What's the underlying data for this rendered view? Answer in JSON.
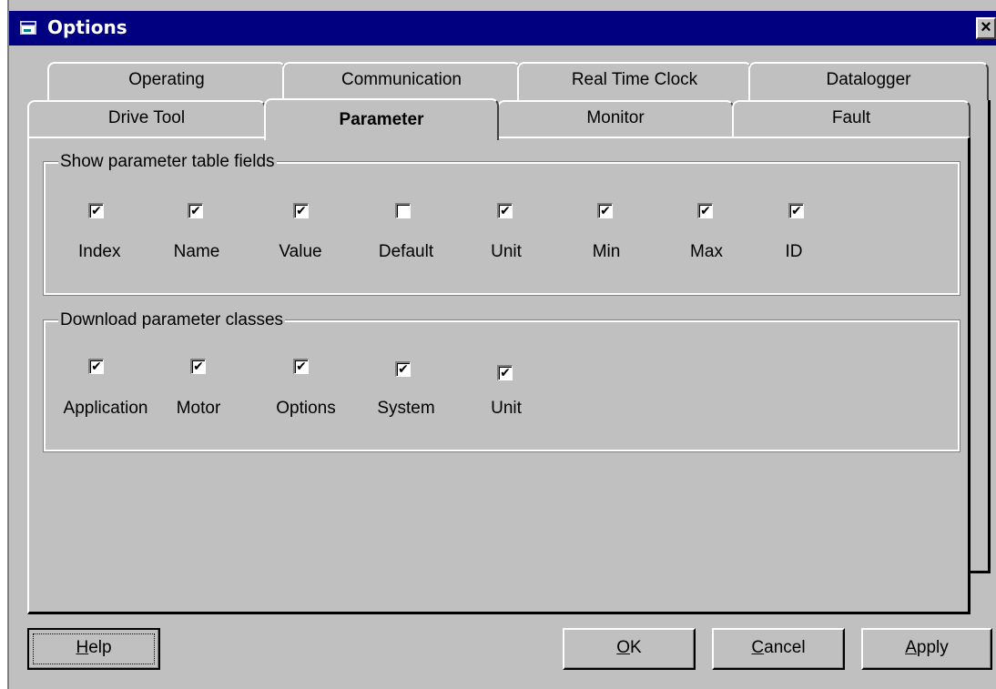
{
  "window": {
    "title": "Options",
    "close_label": "×",
    "app_icon": "app-window-icon"
  },
  "tabs": {
    "row_back": [
      {
        "label": "Operating"
      },
      {
        "label": "Communication"
      },
      {
        "label": "Real Time Clock"
      },
      {
        "label": "Datalogger"
      }
    ],
    "row_front": [
      {
        "label": "Drive Tool"
      },
      {
        "label": "Parameter",
        "active": true
      },
      {
        "label": "Monitor"
      },
      {
        "label": "Fault"
      }
    ]
  },
  "fields_group": {
    "title": "Show parameter table fields",
    "items": [
      {
        "label": "Index",
        "checked": true
      },
      {
        "label": "Name",
        "checked": true
      },
      {
        "label": "Value",
        "checked": true
      },
      {
        "label": "Default",
        "checked": false
      },
      {
        "label": "Unit",
        "checked": true
      },
      {
        "label": "Min",
        "checked": true
      },
      {
        "label": "Max",
        "checked": true
      },
      {
        "label": "ID",
        "checked": true
      }
    ]
  },
  "classes_group": {
    "title": "Download parameter classes",
    "items": [
      {
        "label": "Application",
        "checked": true
      },
      {
        "label": "Motor",
        "checked": true
      },
      {
        "label": "Options",
        "checked": true
      },
      {
        "label": "System",
        "checked": true
      },
      {
        "label": "Unit",
        "checked": true
      }
    ]
  },
  "buttons": {
    "help_mn": "H",
    "help_rest": "elp",
    "ok_mn": "O",
    "ok_rest": "K",
    "cancel_mn": "C",
    "cancel_rest": "ancel",
    "apply_mn": "A",
    "apply_rest": "pply"
  },
  "check_mark": "✔"
}
